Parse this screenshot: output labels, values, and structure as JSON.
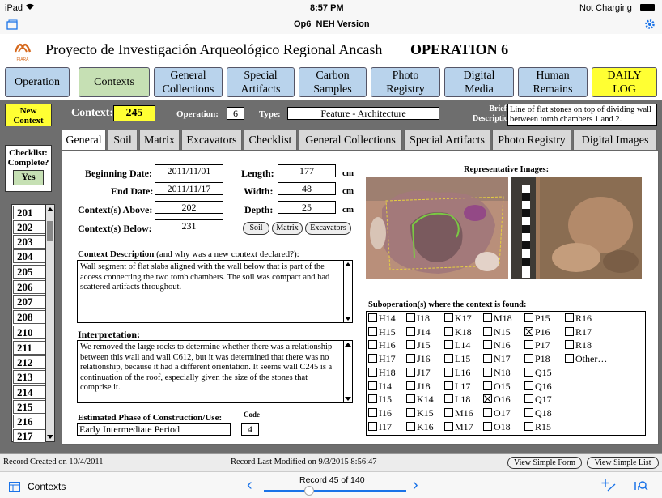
{
  "status": {
    "device": "iPad",
    "time": "8:57 PM",
    "battery_text": "Not Charging",
    "layout_name": "Op6_NEH Version"
  },
  "header": {
    "project_title": "Proyecto de Investigación Arqueológico Regional Ancash",
    "operation_title": "OPERATION 6",
    "logo_text": "PIARA"
  },
  "nav": [
    {
      "label": "Operation"
    },
    {
      "label": "Contexts"
    },
    {
      "label": "General Collections"
    },
    {
      "label": "Special Artifacts"
    },
    {
      "label": "Carbon Samples"
    },
    {
      "label": "Photo Registry"
    },
    {
      "label": "Digital Media"
    },
    {
      "label": "Human Remains"
    },
    {
      "label": "DAILY LOG"
    }
  ],
  "context_bar": {
    "new_context": "New Context",
    "context_label": "Context:",
    "context_value": "245",
    "operation_label": "Operation:",
    "operation_value": "6",
    "type_label": "Type:",
    "type_value": "Feature - Architecture",
    "brief_label": "Brief Description:",
    "brief_value": "Line of flat stones on top of dividing wall between tomb chambers 1 and 2."
  },
  "checklist": {
    "label": "Checklist: Complete?",
    "value": "Yes"
  },
  "context_list": [
    "201",
    "202",
    "203",
    "204",
    "205",
    "206",
    "207",
    "208",
    "210",
    "211",
    "212",
    "213",
    "214",
    "215",
    "216",
    "217"
  ],
  "tabs": [
    "General",
    "Soil",
    "Matrix",
    "Excavators",
    "Checklist",
    "General Collections",
    "Special Artifacts",
    "Photo Registry",
    "Digital Images"
  ],
  "general": {
    "beginning_date_label": "Beginning Date:",
    "beginning_date": "2011/11/01",
    "end_date_label": "End Date:",
    "end_date": "2011/11/17",
    "above_label": "Context(s) Above:",
    "above": "202",
    "below_label": "Context(s) Below:",
    "below": "231",
    "length_label": "Length:",
    "length": "177",
    "width_label": "Width:",
    "width": "48",
    "depth_label": "Depth:",
    "depth": "25",
    "unit": "cm",
    "pill_soil": "Soil",
    "pill_matrix": "Matrix",
    "pill_excavators": "Excavators",
    "desc_label_bold": "Context Description",
    "desc_label_rest": " (and why was a new context declared?):",
    "description": "Wall segment of flat slabs aligned with the wall below that is part of the access connecting the two tomb chambers. The soil was compact and had scattered artifacts throughout.",
    "interp_label": "Interpretation:",
    "interpretation": "We removed the large rocks to determine whether there was a relationship between this wall and wall C612, but it was determined that there was no relationship, because it had a different orientation. It seems wall C245 is a continuation of the roof, especially given the size of the stones that comprise it.",
    "phase_label": "Estimated Phase of Construction/Use:",
    "code_label": "Code",
    "phase": "Early Intermediate Period",
    "code": "4",
    "images_label": "Representative Images:",
    "subop_label": "Suboperation(s) where the context is found:"
  },
  "subops": [
    [
      "H14",
      "I18",
      "K17",
      "M18",
      "P15",
      "R16"
    ],
    [
      "H15",
      "J14",
      "K18",
      "N15",
      "P16",
      "R17"
    ],
    [
      "H16",
      "J15",
      "L14",
      "N16",
      "P17",
      "R18"
    ],
    [
      "H17",
      "J16",
      "L15",
      "N17",
      "P18",
      "Other…"
    ],
    [
      "H18",
      "J17",
      "L16",
      "N18",
      "Q15",
      ""
    ],
    [
      "I14",
      "J18",
      "L17",
      "O15",
      "Q16",
      ""
    ],
    [
      "I15",
      "K14",
      "L18",
      "O16",
      "Q17",
      ""
    ],
    [
      "I16",
      "K15",
      "M16",
      "O17",
      "Q18",
      ""
    ],
    [
      "I17",
      "K16",
      "M17",
      "O18",
      "R15",
      ""
    ]
  ],
  "subops_checked": [
    "P16",
    "O16"
  ],
  "footer": {
    "created": "Record Created on 10/4/2011",
    "modified": "Record Last Modified on 9/3/2015 8:56:47",
    "btn_simple_form": "View Simple Form",
    "btn_simple_list": "View Simple List"
  },
  "toolbar": {
    "layout": "Contexts",
    "record": "Record 45 of 140",
    "record_position": 0.32
  }
}
